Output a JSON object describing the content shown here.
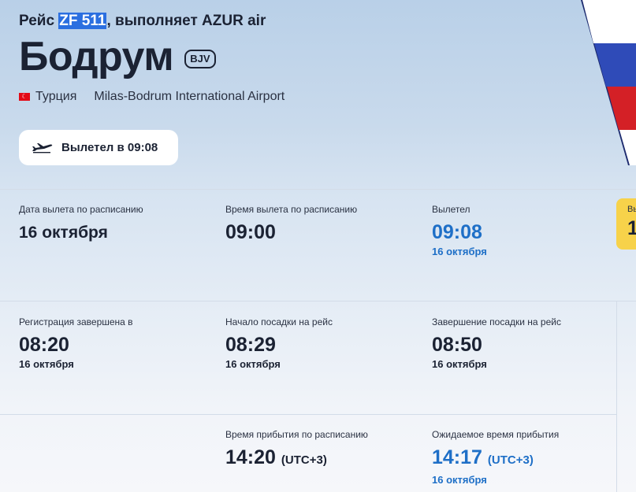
{
  "header": {
    "prefix": "Рейс ",
    "flight_number": "ZF 511",
    "operator": ", выполняет AZUR air",
    "city": "Бодрум",
    "iata": "BJV",
    "country": "Турция",
    "airport": "Milas-Bodrum International Airport"
  },
  "status": {
    "text": "Вылетел в 09:08",
    "icon": "plane-icon"
  },
  "row1": {
    "sched_date_label": "Дата вылета по расписанию",
    "sched_date_value": "16 октября",
    "sched_time_label": "Время вылета по расписанию",
    "sched_time_value": "09:00",
    "departed_label": "Вылетел",
    "departed_value": "09:08",
    "departed_date": "16 октября",
    "card_label": "Вы",
    "card_value": "1"
  },
  "row2": {
    "checkin_label": "Регистрация завершена в",
    "checkin_value": "08:20",
    "checkin_date": "16 октября",
    "boarding_start_label": "Начало посадки на рейс",
    "boarding_start_value": "08:29",
    "boarding_start_date": "16 октября",
    "boarding_end_label": "Завершение посадки на рейс",
    "boarding_end_value": "08:50",
    "boarding_end_date": "16 октября"
  },
  "row3": {
    "sched_arr_label": "Время прибытия по расписанию",
    "sched_arr_value": "14:20",
    "sched_arr_tz": "(UTC+3)",
    "exp_arr_label": "Ожидаемое время прибытия",
    "exp_arr_value": "14:17",
    "exp_arr_tz": "(UTC+3)",
    "exp_arr_date": "16 октября"
  },
  "colors": {
    "accent_blue": "#1e6fc7",
    "highlight": "#2b6fe0",
    "card_yellow": "#f7d24a"
  }
}
